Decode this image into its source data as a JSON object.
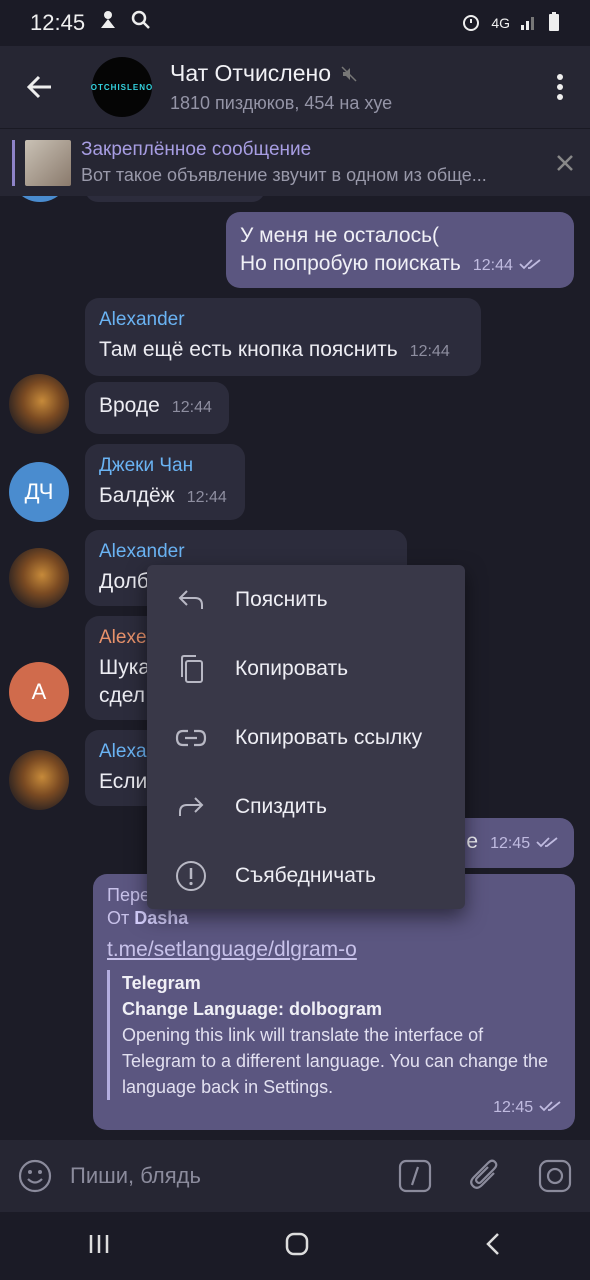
{
  "status": {
    "time": "12:45",
    "network": "4G"
  },
  "header": {
    "avatar_text": "OTCHISLENO",
    "title": "Чат Отчислено",
    "subtitle": "1810 пиздюков, 454 на хуе"
  },
  "pinned": {
    "title": "Закреплённое сообщение",
    "body": "Вот такое объявление звучит в одном из обще..."
  },
  "messages": {
    "m1": {
      "line1": "У меня не осталось(",
      "line2": "Но попробую поискать",
      "time": "12:44"
    },
    "m2": {
      "sender": "Alexander",
      "text": "Там ещё есть кнопка пояснить",
      "time": "12:44"
    },
    "m3": {
      "text": "Вроде",
      "time": "12:44"
    },
    "m4": {
      "sender": "Джеки Чан",
      "text": "Балдёж",
      "time": "12:44",
      "avatar": "ДЧ"
    },
    "m5": {
      "sender": "Alexander",
      "text": "Долб"
    },
    "m6": {
      "sender": "Alexe",
      "line1": "Шука",
      "line2": "сдел",
      "avatar": "A"
    },
    "m7": {
      "sender": "Alexa",
      "text": "Если"
    },
    "m8": {
      "text": "е",
      "time": "12:45"
    },
    "m9": {
      "forward_label": "Пере",
      "from_prefix": "От",
      "from_name": "Dasha",
      "link": "t.me/setlanguage/dlgram-o",
      "preview_site": "Telegram",
      "preview_title": "Change Language: dolbogram",
      "preview_text": "Opening this link will translate the interface of Telegram to a different language. You can change the language back in Settings.",
      "time": "12:45"
    }
  },
  "context_menu": {
    "items": [
      {
        "label": "Пояснить",
        "icon": "reply-icon"
      },
      {
        "label": "Копировать",
        "icon": "copy-icon"
      },
      {
        "label": "Копировать ссылку",
        "icon": "link-icon"
      },
      {
        "label": "Спиздить",
        "icon": "forward-icon"
      },
      {
        "label": "Съябедничать",
        "icon": "report-icon"
      }
    ]
  },
  "composer": {
    "placeholder": "Пиши, блядь"
  }
}
